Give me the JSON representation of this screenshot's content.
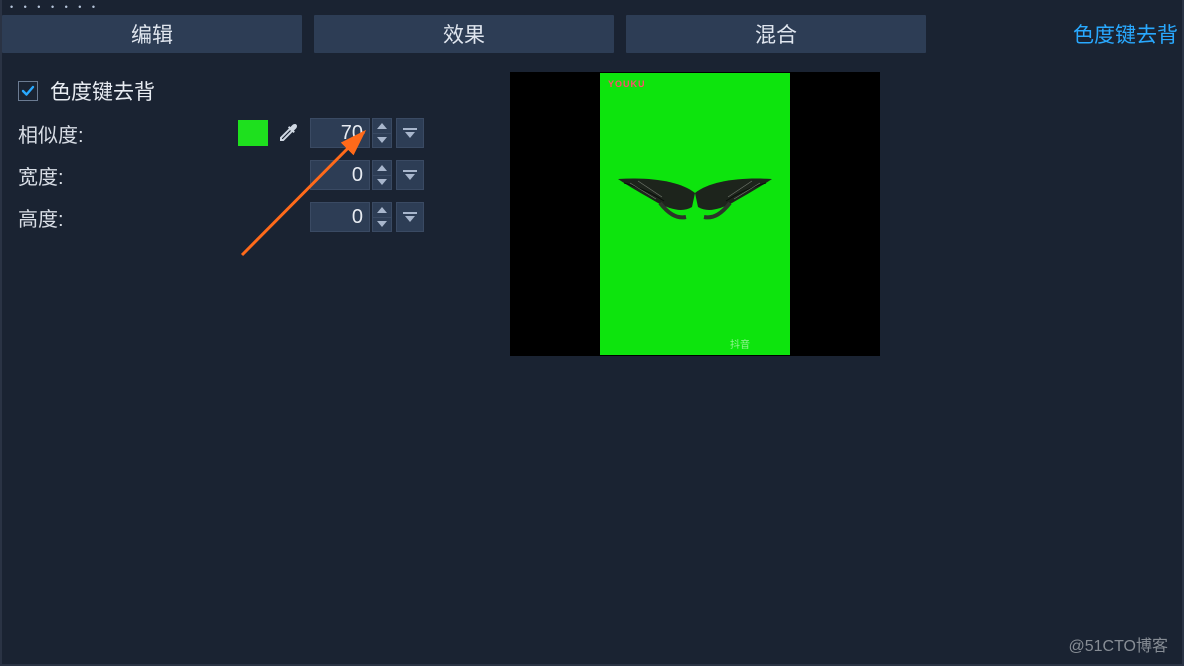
{
  "top_dots": "• • • • • • •",
  "tabs": {
    "edit": "编辑",
    "effect": "效果",
    "blend": "混合",
    "chromakey": "色度键去背"
  },
  "section": {
    "checkbox_checked": true,
    "title": "色度键去背"
  },
  "params": {
    "similarity": {
      "label": "相似度:",
      "value": "70",
      "color": "#1ee01e"
    },
    "width": {
      "label": "宽度:",
      "value": "0"
    },
    "height": {
      "label": "高度:",
      "value": "0"
    }
  },
  "preview": {
    "watermark_top": "YOUKU",
    "watermark_bottom": "抖音"
  },
  "footer_watermark": "@51CTO博客"
}
